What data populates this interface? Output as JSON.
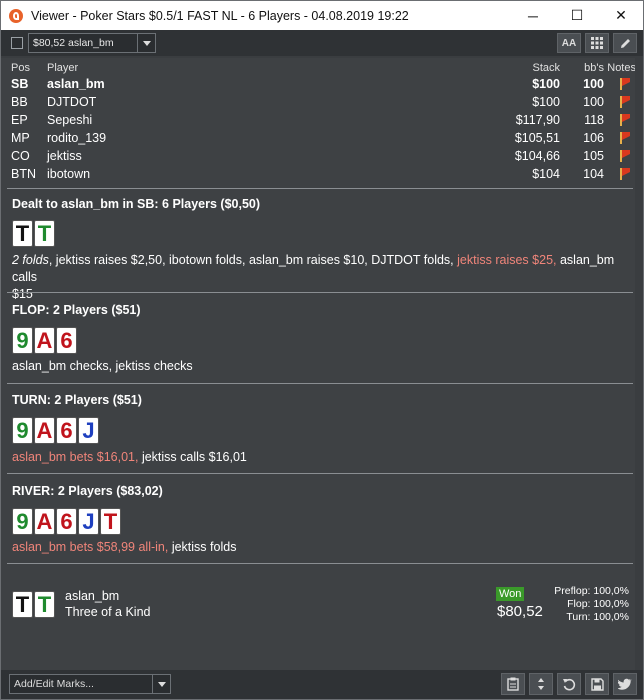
{
  "window": {
    "title": "Viewer - Poker Stars $0.5/1 FAST NL - 6 Players - 04.08.2019 19:22",
    "minimize_glyph": "─",
    "maximize_glyph": "☐",
    "close_glyph": "✕"
  },
  "toolbar": {
    "hand_select_value": "$80,52 aslan_bm",
    "font_button_label": "AA",
    "grid_icon": "grid-icon",
    "edit_icon": "pencil-icon"
  },
  "players_table": {
    "headers": {
      "pos": "Pos",
      "player": "Player",
      "stack": "Stack",
      "bbs": "bb's",
      "notes": "Notes"
    },
    "rows": [
      {
        "pos": "SB",
        "name": "aslan_bm",
        "stack": "$100",
        "bbs": "100",
        "bold": true
      },
      {
        "pos": "BB",
        "name": "DJTDOT",
        "stack": "$100",
        "bbs": "100",
        "bold": false
      },
      {
        "pos": "EP",
        "name": "Sepeshi",
        "stack": "$117,90",
        "bbs": "118",
        "bold": false
      },
      {
        "pos": "MP",
        "name": "rodito_139",
        "stack": "$105,51",
        "bbs": "106",
        "bold": false
      },
      {
        "pos": "CO",
        "name": "jektiss",
        "stack": "$104,66",
        "bbs": "105",
        "bold": false
      },
      {
        "pos": "BTN",
        "name": "ibotown",
        "stack": "$104",
        "bbs": "104",
        "bold": false
      }
    ]
  },
  "preflop": {
    "heading": "Dealt to aslan_bm in SB: 6 Players ($0,50)",
    "cards": [
      {
        "rank": "T",
        "suit": "s"
      },
      {
        "rank": "T",
        "suit": "c"
      }
    ],
    "action_a": "2 folds",
    "action_b": ", jektiss raises $2,50, ibotown folds, aslan_bm raises $10, DJTDOT folds, ",
    "action_hl": "jektiss raises $25,",
    "action_c": " aslan_bm calls",
    "action_d": "$15"
  },
  "flop": {
    "heading": "FLOP: 2 Players ($51)",
    "cards": [
      {
        "rank": "9",
        "suit": "c"
      },
      {
        "rank": "A",
        "suit": "h"
      },
      {
        "rank": "6",
        "suit": "h"
      }
    ],
    "action": "aslan_bm checks, jektiss checks"
  },
  "turn": {
    "heading": "TURN: 2 Players ($51)",
    "cards": [
      {
        "rank": "9",
        "suit": "c"
      },
      {
        "rank": "A",
        "suit": "h"
      },
      {
        "rank": "6",
        "suit": "h"
      },
      {
        "rank": "J",
        "suit": "d"
      }
    ],
    "action_hl": "aslan_bm bets $16,01,",
    "action_rest": " jektiss calls $16,01"
  },
  "river": {
    "heading": "RIVER: 2 Players ($83,02)",
    "cards": [
      {
        "rank": "9",
        "suit": "c"
      },
      {
        "rank": "A",
        "suit": "h"
      },
      {
        "rank": "6",
        "suit": "h"
      },
      {
        "rank": "J",
        "suit": "d"
      },
      {
        "rank": "T",
        "suit": "h"
      }
    ],
    "action_hl": "aslan_bm bets $58,99 all-in,",
    "action_rest": " jektiss folds"
  },
  "summary": {
    "cards": [
      {
        "rank": "T",
        "suit": "s"
      },
      {
        "rank": "T",
        "suit": "c"
      }
    ],
    "player": "aslan_bm",
    "hand": "Three of a Kind",
    "result_label": "Won",
    "amount": "$80,52",
    "equity": [
      {
        "label": "Preflop:",
        "value": "100,0%"
      },
      {
        "label": "Flop:",
        "value": "100,0%"
      },
      {
        "label": "Turn:",
        "value": "100,0%"
      }
    ]
  },
  "bottombar": {
    "marks_label": "Add/Edit Marks...",
    "icons": [
      "clipboard-icon",
      "sort-arrows-icon",
      "undo-icon",
      "save-icon",
      "twitter-icon"
    ]
  },
  "colors": {
    "highlight_action": "#f0857a",
    "won_badge": "#3a9a2a",
    "note_flag": "#d9381e"
  }
}
